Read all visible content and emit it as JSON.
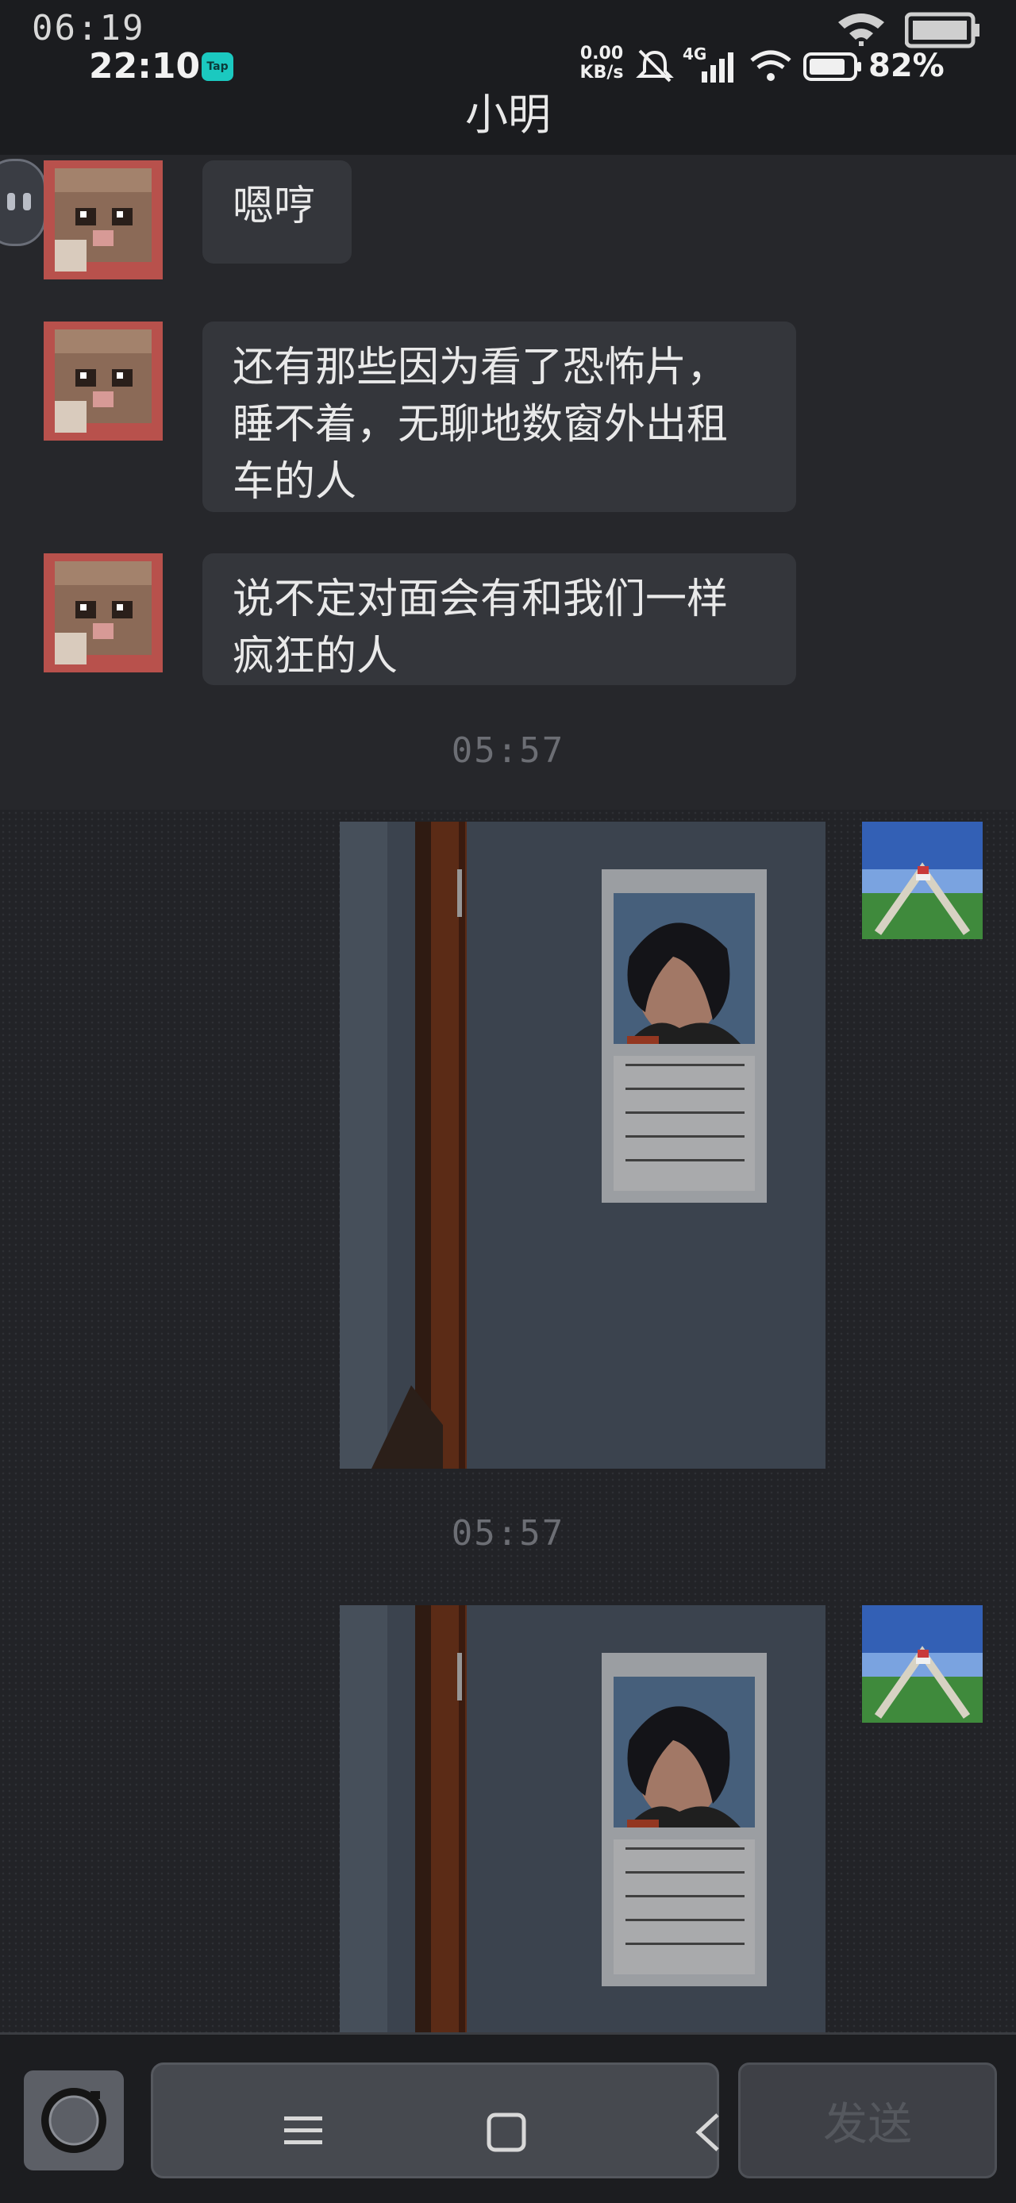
{
  "status_bar": {
    "game_clock": "06:19",
    "real_time": "22:10",
    "tap_badge": "Tap",
    "net_speed_value": "0.00",
    "net_speed_unit": "KB/s",
    "network_type": "4G",
    "battery_percent": "82%"
  },
  "chat": {
    "title": "小明",
    "incoming_messages": [
      "嗯哼",
      "还有那些因为看了恐怖片，睡不着，无聊地数窗外出租车的人",
      "说不定对面会有和我们一样疯狂的人"
    ],
    "timestamps": [
      "05:57",
      "05:57"
    ]
  },
  "composer": {
    "send_label": "发送"
  },
  "icons": {
    "camera": "camera-icon",
    "menu": "menu-icon",
    "home": "home-icon",
    "back": "back-icon"
  }
}
